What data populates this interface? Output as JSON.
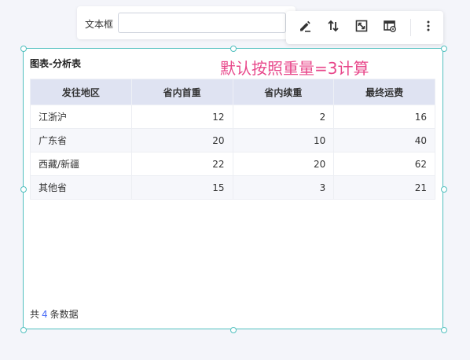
{
  "textbox": {
    "label": "文本框",
    "value": "",
    "placeholder": ""
  },
  "toolbar": {
    "buttons": [
      {
        "icon": "pen-edit-icon"
      },
      {
        "icon": "swap-arrows-icon"
      },
      {
        "icon": "expand-icon"
      },
      {
        "icon": "table-settings-icon"
      },
      {
        "icon": "more-vertical-icon"
      }
    ]
  },
  "widget": {
    "title": "图表-分析表",
    "annotation": "默认按照重量=3计算",
    "accent_color": "#52c0bf",
    "annotation_color": "#e8488b"
  },
  "table": {
    "columns": [
      "发往地区",
      "省内首重",
      "省内续重",
      "最终运费"
    ],
    "rows": [
      [
        "江浙沪",
        "12",
        "2",
        "16"
      ],
      [
        "广东省",
        "20",
        "10",
        "40"
      ],
      [
        "西藏/新疆",
        "22",
        "20",
        "62"
      ],
      [
        "其他省",
        "15",
        "3",
        "21"
      ]
    ]
  },
  "footer": {
    "prefix": "共",
    "count": "4",
    "suffix": "条数据"
  }
}
